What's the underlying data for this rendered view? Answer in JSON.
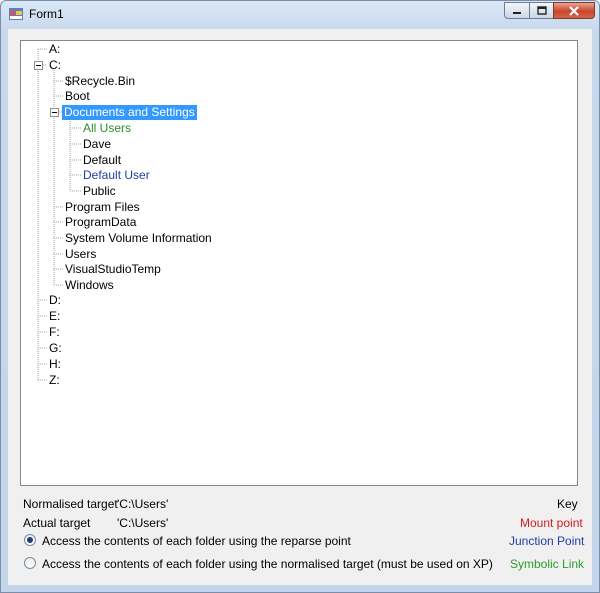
{
  "window": {
    "title": "Form1"
  },
  "tree": {
    "nodes": [
      {
        "label": "A:"
      },
      {
        "label": "C:"
      },
      {
        "label": "$Recycle.Bin"
      },
      {
        "label": "Boot"
      },
      {
        "label": "Documents and Settings"
      },
      {
        "label": "All Users"
      },
      {
        "label": "Dave"
      },
      {
        "label": "Default"
      },
      {
        "label": "Default User"
      },
      {
        "label": "Public"
      },
      {
        "label": "Program Files"
      },
      {
        "label": "ProgramData"
      },
      {
        "label": "System Volume Information"
      },
      {
        "label": "Users"
      },
      {
        "label": "VisualStudioTemp"
      },
      {
        "label": "Windows"
      },
      {
        "label": "D:"
      },
      {
        "label": "E:"
      },
      {
        "label": "F:"
      },
      {
        "label": "G:"
      },
      {
        "label": "H:"
      },
      {
        "label": "Z:"
      }
    ]
  },
  "info": {
    "normalised_target_label": "Normalised target",
    "normalised_target_value": "'C:\\Users'",
    "actual_target_label": "Actual target",
    "actual_target_value": "'C:\\Users'"
  },
  "options": {
    "reparse_label": "Access the contents of each folder using the reparse point",
    "normalised_label": "Access the contents of each folder using the normalised target (must be used on XP)"
  },
  "key": {
    "title": "Key",
    "mount_point": "Mount point",
    "junction_point": "Junction Point",
    "symbolic_link": "Symbolic Link"
  },
  "colors": {
    "mount_point": "#d21c1c",
    "junction_point": "#1f3fa8",
    "symbolic_link": "#2e9b2e",
    "selection": "#3399ff"
  }
}
